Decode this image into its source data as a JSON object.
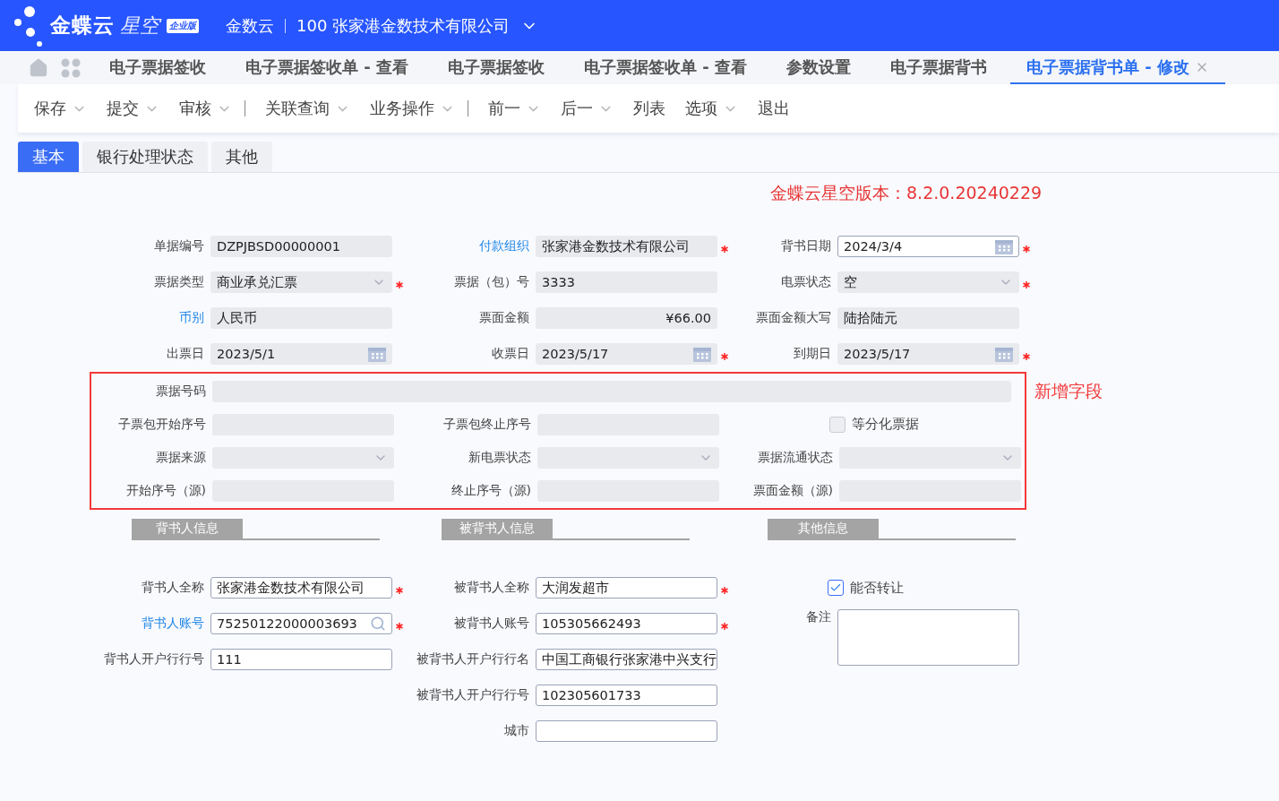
{
  "header": {
    "brand": "金蝶云",
    "product": "星空",
    "edition": "企业版",
    "tenant": "金数云",
    "organization": "100 张家港金数技术有限公司"
  },
  "nav_tabs": [
    {
      "label": "电子票据签收",
      "selected": false
    },
    {
      "label": "电子票据签收单 - 查看",
      "selected": false
    },
    {
      "label": "电子票据签收",
      "selected": false
    },
    {
      "label": "电子票据签收单 - 查看",
      "selected": false
    },
    {
      "label": "参数设置",
      "selected": false
    },
    {
      "label": "电子票据背书",
      "selected": false
    },
    {
      "label": "电子票据背书单 - 修改",
      "selected": true
    }
  ],
  "toolbar": [
    {
      "label": "保存",
      "menu": true,
      "divider_after": false
    },
    {
      "label": "提交",
      "menu": true,
      "divider_after": false
    },
    {
      "label": "审核",
      "menu": true,
      "divider_after": true
    },
    {
      "label": "关联查询",
      "menu": true,
      "divider_after": false
    },
    {
      "label": "业务操作",
      "menu": true,
      "divider_after": true
    },
    {
      "label": "前一",
      "menu": true,
      "divider_after": false
    },
    {
      "label": "后一",
      "menu": true,
      "divider_after": false
    },
    {
      "label": "列表",
      "menu": false,
      "divider_after": false
    },
    {
      "label": "选项",
      "menu": true,
      "divider_after": false
    },
    {
      "label": "退出",
      "menu": false,
      "divider_after": false
    }
  ],
  "form_tabs": [
    {
      "label": "基本",
      "selected": true
    },
    {
      "label": "银行处理状态",
      "selected": false
    },
    {
      "label": "其他",
      "selected": false
    }
  ],
  "version_note": "金蝶云星空版本：8.2.0.20240229",
  "rows": [
    [
      {
        "label": "单据编号",
        "value": "DZPJBSD00000001",
        "kind": "text",
        "required": false,
        "link": false,
        "editable": false
      },
      {
        "label": "付款组织",
        "value": "张家港金数技术有限公司",
        "kind": "text",
        "required": true,
        "link": true,
        "editable": false
      },
      {
        "label": "背书日期",
        "value": "2024/3/4",
        "kind": "date",
        "required": true,
        "link": false,
        "editable": true
      }
    ],
    [
      {
        "label": "票据类型",
        "value": "商业承兑汇票",
        "kind": "select",
        "required": true,
        "link": false,
        "editable": false
      },
      {
        "label": "票据（包）号",
        "value": "3333",
        "kind": "text",
        "required": false,
        "link": false,
        "editable": false
      },
      {
        "label": "电票状态",
        "value": "空",
        "kind": "select",
        "required": true,
        "link": false,
        "editable": false
      }
    ],
    [
      {
        "label": "币别",
        "value": "人民币",
        "kind": "text",
        "required": false,
        "link": true,
        "editable": false
      },
      {
        "label": "票面金额",
        "value": "¥66.00",
        "kind": "amount",
        "required": false,
        "link": false,
        "editable": false
      },
      {
        "label": "票面金额大写",
        "value": "陆拾陆元",
        "kind": "text",
        "required": false,
        "link": false,
        "editable": false
      }
    ],
    [
      {
        "label": "出票日",
        "value": "2023/5/1",
        "kind": "date",
        "required": false,
        "link": false,
        "editable": false
      },
      {
        "label": "收票日",
        "value": "2023/5/17",
        "kind": "date",
        "required": true,
        "link": false,
        "editable": false
      },
      {
        "label": "到期日",
        "value": "2023/5/17",
        "kind": "date",
        "required": true,
        "link": false,
        "editable": false
      }
    ]
  ],
  "new_fields": {
    "note": "新增字段",
    "rows": [
      [
        {
          "label": "票据号码",
          "kind": "wide",
          "required": false,
          "link": false,
          "editable": false
        }
      ],
      [
        {
          "label": "子票包开始序号",
          "kind": "text",
          "required": false,
          "link": false,
          "editable": false
        },
        {
          "label": "子票包终止序号",
          "kind": "text",
          "required": false,
          "link": false,
          "editable": false
        },
        {
          "label": "等分化票据",
          "kind": "checkbox",
          "checked": false
        }
      ],
      [
        {
          "label": "票据来源",
          "kind": "select",
          "required": false,
          "link": false,
          "editable": false
        },
        {
          "label": "新电票状态",
          "kind": "select",
          "required": false,
          "link": false,
          "editable": false
        },
        {
          "label": "票据流通状态",
          "kind": "select",
          "required": false,
          "link": false,
          "editable": false
        }
      ],
      [
        {
          "label": "开始序号（源)",
          "kind": "text",
          "required": false,
          "link": false,
          "editable": false
        },
        {
          "label": "终止序号（源)",
          "kind": "text",
          "required": false,
          "link": false,
          "editable": false
        },
        {
          "label": "票面金额（源)",
          "kind": "text",
          "required": false,
          "link": false,
          "editable": false
        }
      ]
    ]
  },
  "sections": [
    {
      "title": "背书人信息",
      "fields": [
        {
          "label": "背书人全称",
          "value": "张家港金数技术有限公司",
          "kind": "text",
          "required": true,
          "link": false,
          "editable": true
        },
        {
          "label": "背书人账号",
          "value": "75250122000003693",
          "kind": "lookup",
          "required": true,
          "link": true,
          "editable": true
        },
        {
          "label": "背书人开户行行号",
          "value": "111",
          "kind": "text",
          "required": false,
          "link": false,
          "editable": true
        }
      ]
    },
    {
      "title": "被背书人信息",
      "fields": [
        {
          "label": "被背书人全称",
          "value": "大润发超市",
          "kind": "text",
          "required": true,
          "link": false,
          "editable": true
        },
        {
          "label": "被背书人账号",
          "value": "105305662493",
          "kind": "text",
          "required": true,
          "link": false,
          "editable": true
        },
        {
          "label": "被背书人开户行行名",
          "value": "中国工商银行张家港中兴支行",
          "kind": "text",
          "required": false,
          "link": false,
          "editable": true
        },
        {
          "label": "被背书人开户行行号",
          "value": "102305601733",
          "kind": "text",
          "required": false,
          "link": false,
          "editable": true
        },
        {
          "label": "城市",
          "kind": "text",
          "required": false,
          "link": false,
          "editable": true
        }
      ]
    },
    {
      "title": "其他信息",
      "fields": [
        {
          "label": "能否转让",
          "kind": "checkbox",
          "checked": true
        },
        {
          "label": "备注",
          "kind": "textarea",
          "required": false,
          "link": false,
          "editable": true
        }
      ]
    }
  ]
}
